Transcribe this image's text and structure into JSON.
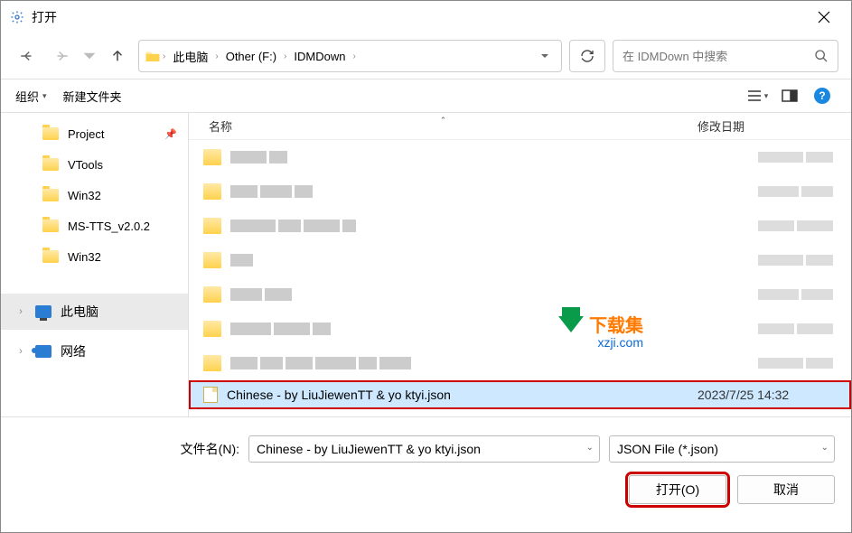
{
  "window": {
    "title": "打开"
  },
  "breadcrumb": {
    "root": "此电脑",
    "drive": "Other (F:)",
    "folder": "IDMDown"
  },
  "search": {
    "placeholder": "在 IDMDown 中搜索"
  },
  "toolbar": {
    "organize": "组织",
    "new_folder": "新建文件夹"
  },
  "columns": {
    "name": "名称",
    "date": "修改日期"
  },
  "sidebar": {
    "items": [
      {
        "label": "Project",
        "pinned": true
      },
      {
        "label": "VTools",
        "pinned": false
      },
      {
        "label": "Win32",
        "pinned": false
      },
      {
        "label": "MS-TTS_v2.0.2",
        "pinned": false
      },
      {
        "label": "Win32",
        "pinned": false
      }
    ],
    "this_pc": "此电脑",
    "network": "网络"
  },
  "selected_file": {
    "name": "Chinese - by LiuJiewenTT & yo ktyi.json",
    "date": "2023/7/25 14:32"
  },
  "filename": {
    "label": "文件名(N):",
    "value": "Chinese - by LiuJiewenTT & yo ktyi.json"
  },
  "filetype": {
    "label": "JSON File (*.json)"
  },
  "buttons": {
    "open": "打开(O)",
    "cancel": "取消"
  },
  "watermark": {
    "text1": "下载集",
    "text2": "xzji.com"
  }
}
